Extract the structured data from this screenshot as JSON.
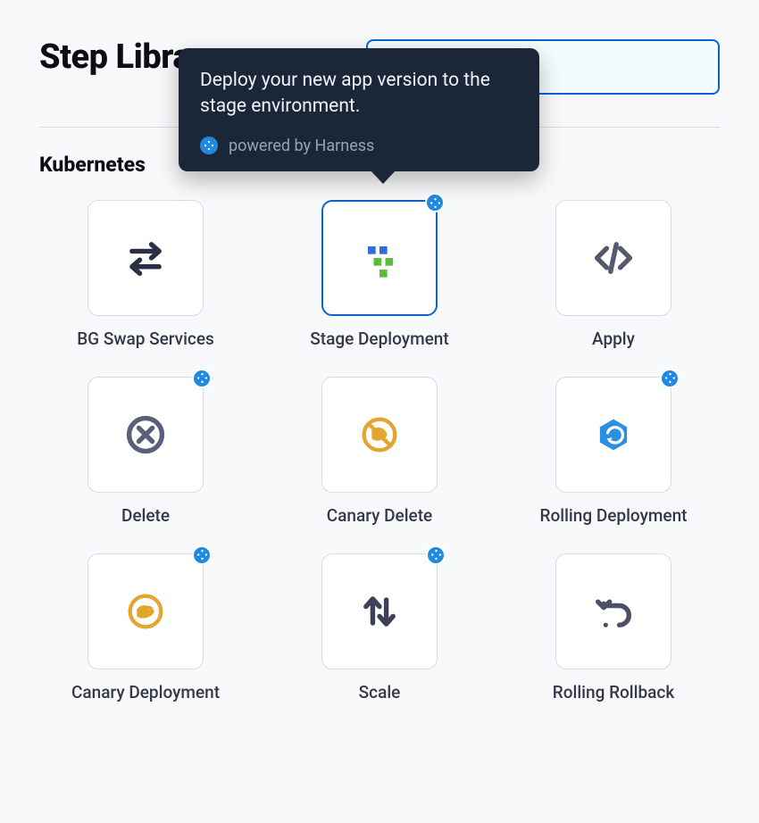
{
  "header": {
    "title": "Step Library"
  },
  "section": {
    "title": "Kubernetes"
  },
  "tooltip": {
    "text": "Deploy your new app version to the stage environment.",
    "powered_by": "powered by Harness"
  },
  "items": [
    {
      "label": "BG Swap Services",
      "badge": false,
      "selected": false,
      "icon": "swap"
    },
    {
      "label": "Stage Deployment",
      "badge": true,
      "selected": true,
      "icon": "grid"
    },
    {
      "label": "Apply",
      "badge": false,
      "selected": false,
      "icon": "code"
    },
    {
      "label": "Delete",
      "badge": true,
      "selected": false,
      "icon": "circle-x"
    },
    {
      "label": "Canary Delete",
      "badge": false,
      "selected": false,
      "icon": "canary-x"
    },
    {
      "label": "Rolling Deployment",
      "badge": true,
      "selected": false,
      "icon": "rolling"
    },
    {
      "label": "Canary Deployment",
      "badge": true,
      "selected": false,
      "icon": "canary"
    },
    {
      "label": "Scale",
      "badge": true,
      "selected": false,
      "icon": "scale"
    },
    {
      "label": "Rolling Rollback",
      "badge": false,
      "selected": false,
      "icon": "rollback"
    }
  ]
}
